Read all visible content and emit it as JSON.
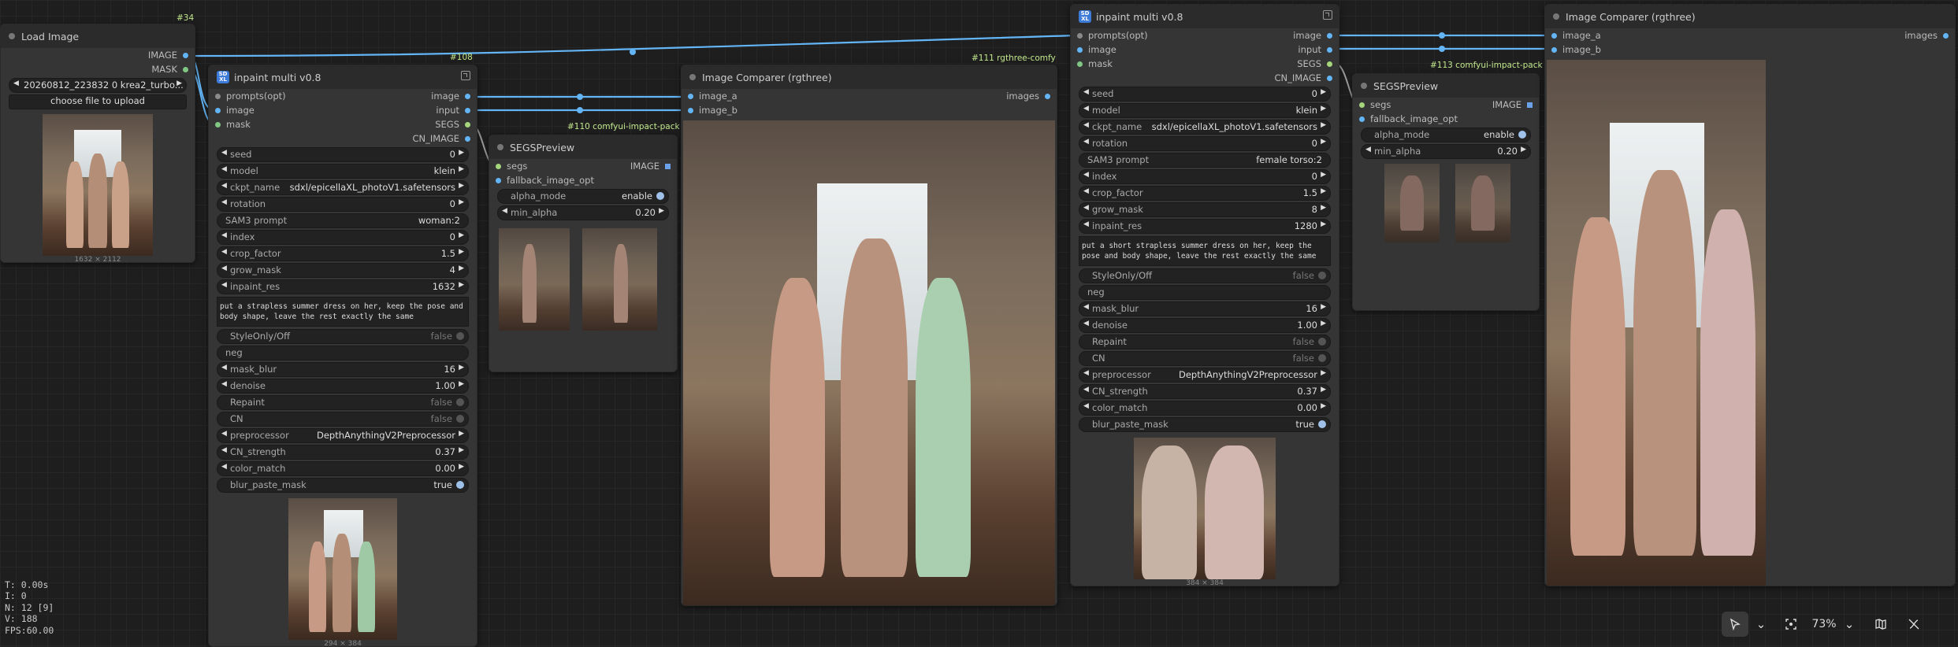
{
  "canvas": {
    "node_id_34": "#34",
    "link_labels": {
      "l108": "#108",
      "l110": "#110 comfyui-impact-pack",
      "l111": "#111 rgthree-comfy",
      "l113": "#113 comfyui-impact-pack"
    }
  },
  "load_image": {
    "title": "Load Image",
    "outputs": [
      "IMAGE",
      "MASK"
    ],
    "file": "20260812_223832 0 krea2_turbo...",
    "upload_label": "choose file to upload",
    "image_size": "1632 × 2112"
  },
  "inpaint1": {
    "title": "inpaint multi v0.8",
    "logo": "SD XL",
    "inputs": [
      "prompts(opt)",
      "image",
      "mask"
    ],
    "outputs": [
      "image",
      "input",
      "SEGS",
      "CN_IMAGE"
    ],
    "widgets": [
      {
        "label": "seed",
        "value": "0"
      },
      {
        "label": "model",
        "value": "klein"
      },
      {
        "label": "ckpt_name",
        "value": "sdxl/epicellaXL_photoV1.safetensors"
      },
      {
        "label": "rotation",
        "value": "0"
      },
      {
        "label": "SAM3 prompt",
        "value": "woman:2"
      },
      {
        "label": "index",
        "value": "0"
      },
      {
        "label": "crop_factor",
        "value": "1.5"
      },
      {
        "label": "grow_mask",
        "value": "4"
      },
      {
        "label": "inpaint_res",
        "value": "1632"
      }
    ],
    "prompt": "put a strapless summer dress on her, keep the pose and body shape, leave the rest exactly the same",
    "widgets2": [
      {
        "label": "StyleOnly/Off",
        "value": "false"
      },
      {
        "label": "neg",
        "value": ""
      },
      {
        "label": "mask_blur",
        "value": "16"
      },
      {
        "label": "denoise",
        "value": "1.00"
      },
      {
        "label": "Repaint",
        "value": "false"
      },
      {
        "label": "CN",
        "value": "false"
      },
      {
        "label": "preprocessor",
        "value": "DepthAnythingV2Preprocessor"
      },
      {
        "label": "CN_strength",
        "value": "0.37"
      },
      {
        "label": "color_match",
        "value": "0.00"
      },
      {
        "label": "blur_paste_mask",
        "value": "true"
      }
    ],
    "image_size": "294 × 384"
  },
  "segs1": {
    "title": "SEGSPreview",
    "inputs": [
      "segs",
      "fallback_image_opt"
    ],
    "output": "IMAGE",
    "alpha_mode": {
      "label": "alpha_mode",
      "value": "enable"
    },
    "min_alpha": {
      "label": "min_alpha",
      "value": "0.20"
    }
  },
  "comparer1": {
    "title": "Image Comparer (rgthree)",
    "inputs": [
      "image_a",
      "image_b"
    ],
    "output": "images"
  },
  "inpaint2": {
    "title": "inpaint multi v0.8",
    "logo": "SD XL",
    "inputs": [
      "prompts(opt)",
      "image",
      "mask"
    ],
    "outputs": [
      "image",
      "input",
      "SEGS",
      "CN_IMAGE"
    ],
    "widgets": [
      {
        "label": "seed",
        "value": "0"
      },
      {
        "label": "model",
        "value": "klein"
      },
      {
        "label": "ckpt_name",
        "value": "sdxl/epicellaXL_photoV1.safetensors"
      },
      {
        "label": "rotation",
        "value": "0"
      },
      {
        "label": "SAM3 prompt",
        "value": "female torso:2"
      },
      {
        "label": "index",
        "value": "0"
      },
      {
        "label": "crop_factor",
        "value": "1.5"
      },
      {
        "label": "grow_mask",
        "value": "8"
      },
      {
        "label": "inpaint_res",
        "value": "1280"
      }
    ],
    "prompt": "put a short strapless summer dress on her, keep the pose and body shape, leave the rest exactly the same",
    "widgets2": [
      {
        "label": "StyleOnly/Off",
        "value": "false"
      },
      {
        "label": "neg",
        "value": ""
      },
      {
        "label": "mask_blur",
        "value": "16"
      },
      {
        "label": "denoise",
        "value": "1.00"
      },
      {
        "label": "Repaint",
        "value": "false"
      },
      {
        "label": "CN",
        "value": "false"
      },
      {
        "label": "preprocessor",
        "value": "DepthAnythingV2Preprocessor"
      },
      {
        "label": "CN_strength",
        "value": "0.37"
      },
      {
        "label": "color_match",
        "value": "0.00"
      },
      {
        "label": "blur_paste_mask",
        "value": "true"
      }
    ],
    "image_size": "384 × 384"
  },
  "segs2": {
    "title": "SEGSPreview",
    "inputs": [
      "segs",
      "fallback_image_opt"
    ],
    "output": "IMAGE",
    "alpha_mode": {
      "label": "alpha_mode",
      "value": "enable"
    },
    "min_alpha": {
      "label": "min_alpha",
      "value": "0.20"
    }
  },
  "comparer2": {
    "title": "Image Comparer (rgthree)",
    "inputs": [
      "image_a",
      "image_b"
    ],
    "output": "images"
  },
  "stats": [
    "T: 0.00s",
    "I: 0",
    "N: 12 [9]",
    "V: 188",
    "FPS:60.00"
  ],
  "toolbar": {
    "zoom": "73%"
  },
  "colors": {
    "image_link": "#64b5f6",
    "segs_link": "#9e9e9e",
    "link_label": "#c3e88d"
  }
}
